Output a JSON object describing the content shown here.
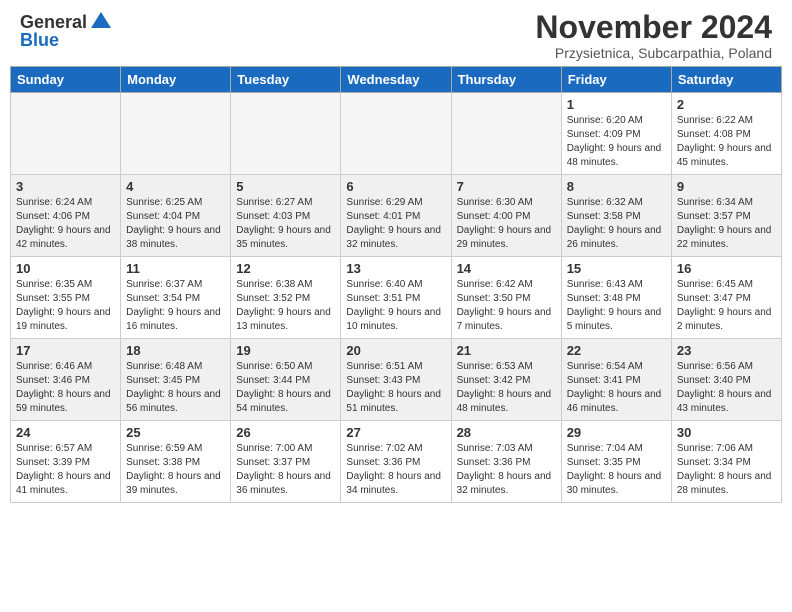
{
  "header": {
    "logo_general": "General",
    "logo_blue": "Blue",
    "month_title": "November 2024",
    "location": "Przysietnica, Subcarpathia, Poland"
  },
  "columns": [
    "Sunday",
    "Monday",
    "Tuesday",
    "Wednesday",
    "Thursday",
    "Friday",
    "Saturday"
  ],
  "weeks": [
    {
      "shaded": false,
      "days": [
        {
          "num": "",
          "info": ""
        },
        {
          "num": "",
          "info": ""
        },
        {
          "num": "",
          "info": ""
        },
        {
          "num": "",
          "info": ""
        },
        {
          "num": "",
          "info": ""
        },
        {
          "num": "1",
          "info": "Sunrise: 6:20 AM\nSunset: 4:09 PM\nDaylight: 9 hours and 48 minutes."
        },
        {
          "num": "2",
          "info": "Sunrise: 6:22 AM\nSunset: 4:08 PM\nDaylight: 9 hours and 45 minutes."
        }
      ]
    },
    {
      "shaded": true,
      "days": [
        {
          "num": "3",
          "info": "Sunrise: 6:24 AM\nSunset: 4:06 PM\nDaylight: 9 hours and 42 minutes."
        },
        {
          "num": "4",
          "info": "Sunrise: 6:25 AM\nSunset: 4:04 PM\nDaylight: 9 hours and 38 minutes."
        },
        {
          "num": "5",
          "info": "Sunrise: 6:27 AM\nSunset: 4:03 PM\nDaylight: 9 hours and 35 minutes."
        },
        {
          "num": "6",
          "info": "Sunrise: 6:29 AM\nSunset: 4:01 PM\nDaylight: 9 hours and 32 minutes."
        },
        {
          "num": "7",
          "info": "Sunrise: 6:30 AM\nSunset: 4:00 PM\nDaylight: 9 hours and 29 minutes."
        },
        {
          "num": "8",
          "info": "Sunrise: 6:32 AM\nSunset: 3:58 PM\nDaylight: 9 hours and 26 minutes."
        },
        {
          "num": "9",
          "info": "Sunrise: 6:34 AM\nSunset: 3:57 PM\nDaylight: 9 hours and 22 minutes."
        }
      ]
    },
    {
      "shaded": false,
      "days": [
        {
          "num": "10",
          "info": "Sunrise: 6:35 AM\nSunset: 3:55 PM\nDaylight: 9 hours and 19 minutes."
        },
        {
          "num": "11",
          "info": "Sunrise: 6:37 AM\nSunset: 3:54 PM\nDaylight: 9 hours and 16 minutes."
        },
        {
          "num": "12",
          "info": "Sunrise: 6:38 AM\nSunset: 3:52 PM\nDaylight: 9 hours and 13 minutes."
        },
        {
          "num": "13",
          "info": "Sunrise: 6:40 AM\nSunset: 3:51 PM\nDaylight: 9 hours and 10 minutes."
        },
        {
          "num": "14",
          "info": "Sunrise: 6:42 AM\nSunset: 3:50 PM\nDaylight: 9 hours and 7 minutes."
        },
        {
          "num": "15",
          "info": "Sunrise: 6:43 AM\nSunset: 3:48 PM\nDaylight: 9 hours and 5 minutes."
        },
        {
          "num": "16",
          "info": "Sunrise: 6:45 AM\nSunset: 3:47 PM\nDaylight: 9 hours and 2 minutes."
        }
      ]
    },
    {
      "shaded": true,
      "days": [
        {
          "num": "17",
          "info": "Sunrise: 6:46 AM\nSunset: 3:46 PM\nDaylight: 8 hours and 59 minutes."
        },
        {
          "num": "18",
          "info": "Sunrise: 6:48 AM\nSunset: 3:45 PM\nDaylight: 8 hours and 56 minutes."
        },
        {
          "num": "19",
          "info": "Sunrise: 6:50 AM\nSunset: 3:44 PM\nDaylight: 8 hours and 54 minutes."
        },
        {
          "num": "20",
          "info": "Sunrise: 6:51 AM\nSunset: 3:43 PM\nDaylight: 8 hours and 51 minutes."
        },
        {
          "num": "21",
          "info": "Sunrise: 6:53 AM\nSunset: 3:42 PM\nDaylight: 8 hours and 48 minutes."
        },
        {
          "num": "22",
          "info": "Sunrise: 6:54 AM\nSunset: 3:41 PM\nDaylight: 8 hours and 46 minutes."
        },
        {
          "num": "23",
          "info": "Sunrise: 6:56 AM\nSunset: 3:40 PM\nDaylight: 8 hours and 43 minutes."
        }
      ]
    },
    {
      "shaded": false,
      "days": [
        {
          "num": "24",
          "info": "Sunrise: 6:57 AM\nSunset: 3:39 PM\nDaylight: 8 hours and 41 minutes."
        },
        {
          "num": "25",
          "info": "Sunrise: 6:59 AM\nSunset: 3:38 PM\nDaylight: 8 hours and 39 minutes."
        },
        {
          "num": "26",
          "info": "Sunrise: 7:00 AM\nSunset: 3:37 PM\nDaylight: 8 hours and 36 minutes."
        },
        {
          "num": "27",
          "info": "Sunrise: 7:02 AM\nSunset: 3:36 PM\nDaylight: 8 hours and 34 minutes."
        },
        {
          "num": "28",
          "info": "Sunrise: 7:03 AM\nSunset: 3:36 PM\nDaylight: 8 hours and 32 minutes."
        },
        {
          "num": "29",
          "info": "Sunrise: 7:04 AM\nSunset: 3:35 PM\nDaylight: 8 hours and 30 minutes."
        },
        {
          "num": "30",
          "info": "Sunrise: 7:06 AM\nSunset: 3:34 PM\nDaylight: 8 hours and 28 minutes."
        }
      ]
    }
  ]
}
